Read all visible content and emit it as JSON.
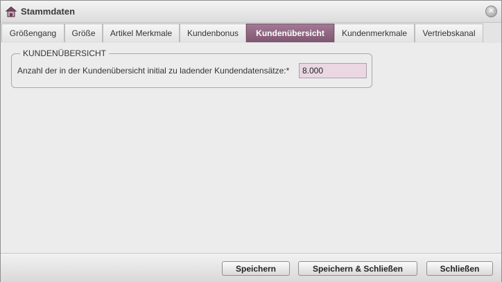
{
  "window": {
    "title": "Stammdaten",
    "app_icon": "house-icon",
    "close_icon": "close-icon",
    "close_glyph": "✕"
  },
  "tabs": [
    {
      "label": "Größengang",
      "active": false
    },
    {
      "label": "Größe",
      "active": false
    },
    {
      "label": "Artikel Merkmale",
      "active": false
    },
    {
      "label": "Kundenbonus",
      "active": false
    },
    {
      "label": "Kundenübersicht",
      "active": true
    },
    {
      "label": "Kundenmerkmale",
      "active": false
    },
    {
      "label": "Vertriebskanal",
      "active": false
    }
  ],
  "section": {
    "legend": "KUNDENÜBERSICHT",
    "field_label": "Anzahl der in der Kundenübersicht initial zu ladender Kundendatensätze:*",
    "field_value": "8.000"
  },
  "footer": {
    "save_label": "Speichern",
    "save_close_label": "Speichern & Schließen",
    "close_label": "Schließen"
  },
  "colors": {
    "active_tab": "#8e6481",
    "input_background": "#ead7e2"
  }
}
